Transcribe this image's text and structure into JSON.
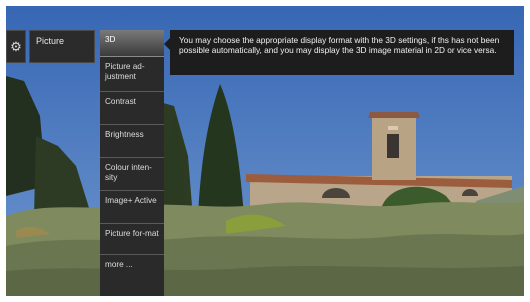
{
  "settings_icon": "gear-icon",
  "breadcrumb": {
    "label": "Picture"
  },
  "menu": {
    "items": [
      {
        "label": "3D",
        "selected": true
      },
      {
        "label": "Picture ad-justment"
      },
      {
        "label": "Contrast"
      },
      {
        "label": "Brightness"
      },
      {
        "label": "Colour inten-sity"
      },
      {
        "label": "Image+ Active"
      },
      {
        "label": "Picture for-mat"
      },
      {
        "label": "more ..."
      }
    ]
  },
  "info": {
    "text": "You may choose the appropriate display format with the 3D settings, if ths has not been possible automatically, and you may display the 3D image material in 2D or vice versa."
  },
  "colors": {
    "menu_background": "#2a2a2a",
    "selected_item": "#7a7a7a",
    "info_background": "#1d1d1d"
  }
}
